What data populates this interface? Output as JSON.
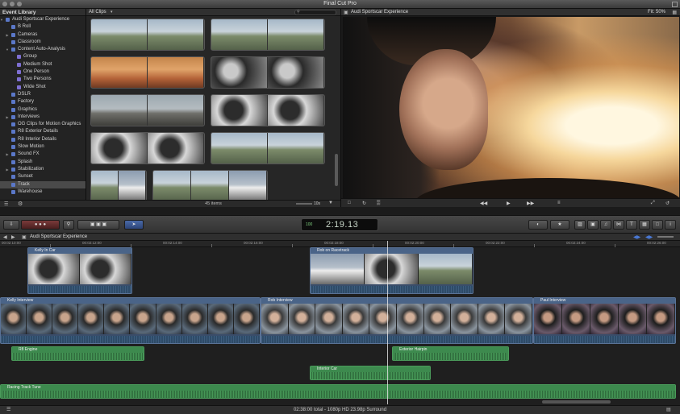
{
  "window": {
    "title": "Final Cut Pro"
  },
  "library": {
    "header": "Event Library",
    "items": [
      {
        "label": "Audi Sportscar Experience",
        "level": 0,
        "type": "event",
        "expanded": true
      },
      {
        "label": "B Roll",
        "level": 1,
        "type": "keyword"
      },
      {
        "label": "Cameras",
        "level": 1,
        "type": "folder",
        "expandable": true
      },
      {
        "label": "Classroom",
        "level": 1,
        "type": "keyword"
      },
      {
        "label": "Content Auto-Analysis",
        "level": 1,
        "type": "folder",
        "expanded": true
      },
      {
        "label": "Group",
        "level": 2,
        "type": "keyword"
      },
      {
        "label": "Medium Shot",
        "level": 2,
        "type": "keyword"
      },
      {
        "label": "One Person",
        "level": 2,
        "type": "keyword"
      },
      {
        "label": "Two Persons",
        "level": 2,
        "type": "keyword"
      },
      {
        "label": "Wide Shot",
        "level": 2,
        "type": "keyword"
      },
      {
        "label": "DSLR",
        "level": 1,
        "type": "keyword"
      },
      {
        "label": "Factory",
        "level": 1,
        "type": "keyword"
      },
      {
        "label": "Graphics",
        "level": 1,
        "type": "keyword"
      },
      {
        "label": "Interviews",
        "level": 1,
        "type": "folder",
        "expandable": true
      },
      {
        "label": "OG Clips for Motion Graphics",
        "level": 1,
        "type": "keyword"
      },
      {
        "label": "R8 Exterior Details",
        "level": 1,
        "type": "keyword"
      },
      {
        "label": "R8 Interior Details",
        "level": 1,
        "type": "keyword"
      },
      {
        "label": "Slow Motion",
        "level": 1,
        "type": "keyword"
      },
      {
        "label": "Sound FX",
        "level": 1,
        "type": "folder",
        "expandable": true
      },
      {
        "label": "Splash",
        "level": 1,
        "type": "keyword"
      },
      {
        "label": "Stabilization",
        "level": 1,
        "type": "folder",
        "expandable": true
      },
      {
        "label": "Sunset",
        "level": 1,
        "type": "keyword"
      },
      {
        "label": "Track",
        "level": 1,
        "type": "keyword",
        "selected": true
      },
      {
        "label": "Warehouse",
        "level": 1,
        "type": "keyword"
      }
    ]
  },
  "browser": {
    "filter": "All Clips",
    "item_count": "45 items",
    "zoom_label": "10s",
    "filmstrips": [
      [
        "road",
        "road"
      ],
      [
        "road",
        "road"
      ],
      [
        "sunset",
        "sunset"
      ],
      [
        "cabin",
        "cabin"
      ],
      [
        "track",
        "track"
      ],
      [
        "driver",
        "driver"
      ],
      [
        "driver",
        "driver"
      ],
      [
        "road",
        "road"
      ],
      [
        "road",
        "car"
      ],
      [
        "road",
        "road",
        "car"
      ]
    ]
  },
  "viewer": {
    "title": "Audi Sportscar Experience",
    "fit": "Fit:",
    "zoom": "50%"
  },
  "toolbar": {
    "timecode": "2:19.13",
    "percent": "100"
  },
  "timeline": {
    "project_name": "Audi Sportscar Experience",
    "ruler": [
      "00:02:10:00",
      "00:02:12:00",
      "00:02:14:00",
      "00:02:16:00",
      "00:02:18:00",
      "00:02:20:00",
      "00:02:22:00",
      "00:02:24:00",
      "00:02:26:00"
    ],
    "connected_clips": [
      {
        "name": "Kelly In Car",
        "frames": [
          "driver",
          "driver"
        ]
      },
      {
        "name": "Rob on Racetrack",
        "frames": [
          "car",
          "driver",
          "road"
        ]
      }
    ],
    "primary_clips": [
      {
        "name": "Kelly Interview",
        "frames": [
          "iv1",
          "iv1",
          "iv1",
          "iv1",
          "iv1",
          "iv1",
          "iv1",
          "iv1",
          "iv1",
          "iv1"
        ]
      },
      {
        "name": "Rob Interview",
        "frames": [
          "iv2",
          "iv2",
          "iv2",
          "iv2",
          "iv2",
          "iv2",
          "iv2",
          "iv2",
          "iv2",
          "iv2"
        ]
      },
      {
        "name": "Paul Interview",
        "frames": [
          "iv3",
          "iv3",
          "iv3",
          "iv3",
          "iv3"
        ]
      }
    ],
    "audio_clips": [
      {
        "name": "R8 Engine"
      },
      {
        "name": "Exterior Hairpin"
      },
      {
        "name": "Interior Car"
      },
      {
        "name": "Racing Track Tune"
      }
    ]
  },
  "status": {
    "text": "02:38:00 total - 1080p HD 23.98p Surround"
  }
}
